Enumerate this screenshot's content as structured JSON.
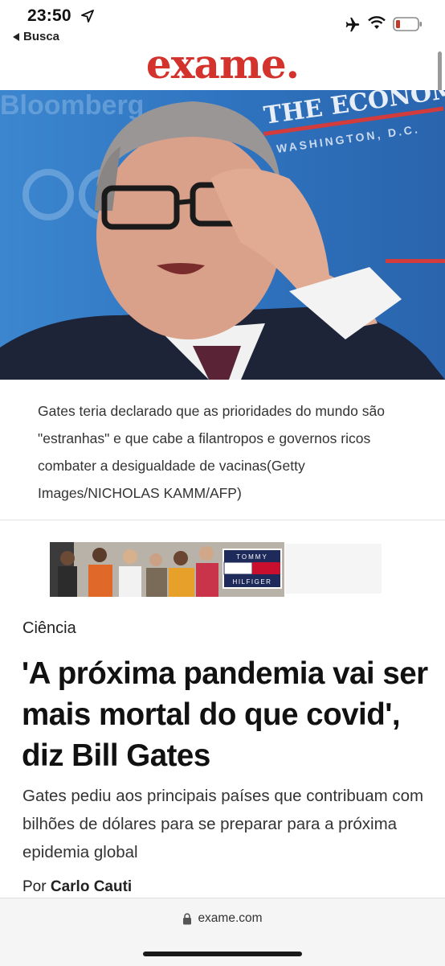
{
  "status_bar": {
    "time": "23:50",
    "back_label": "Busca",
    "icons": [
      "location-arrow-icon",
      "airplane-icon",
      "wifi-icon",
      "battery-icon"
    ],
    "battery_color": "#c0392b"
  },
  "site": {
    "logo_text": "exame.",
    "brand_color": "#d4322c",
    "url": "exame.com"
  },
  "hero": {
    "background_text_left": "Bloomberg",
    "background_text_right": "THE ECONOMIST",
    "background_text_right_sub": "WASHINGTON, D.C."
  },
  "caption": "Gates teria declarado que as prioridades do mundo são \"estranhas\" e que cabe a filantropos e governos ricos combater a desigualdade de vacinas(Getty Images/NICHOLAS KAMM/AFP)",
  "ad": {
    "brand_line1": "TOMMY",
    "brand_line2": "HILFIGER"
  },
  "article": {
    "category": "Ciência",
    "headline": "'A próxima pandemia vai ser mais mortal do que covid', diz Bill Gates",
    "subhead": "Gates pediu aos principais países que contribuam com bilhões de dólares para se preparar para a próxima epidemia global",
    "byline_prefix": "Por",
    "author": "Carlo Cauti"
  }
}
